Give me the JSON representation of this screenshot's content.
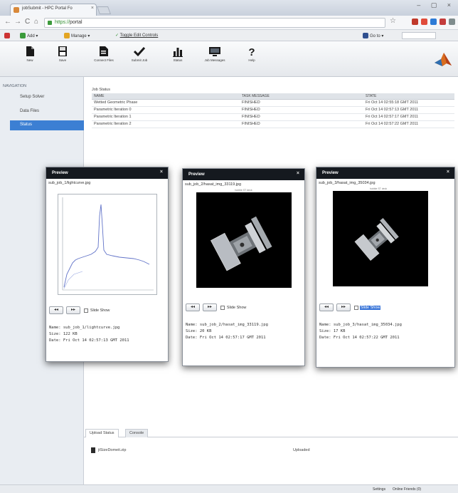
{
  "browser": {
    "tab_title": "jobSubmit - HPC Portal Fo",
    "tab_close": "×",
    "window_buttons": "– ▢ ×",
    "url_scheme": "https://",
    "url_rest": "portal",
    "bookmarks": {
      "add": "Add ▾",
      "manage": "Manage ▾",
      "toggle_edit": "Toggle Edit Controls",
      "go_to": "Go to ▾"
    },
    "ext_colors": [
      "#c0392b",
      "#e04b3a",
      "#2d7bd6",
      "#c43c3c",
      "#7f8c8d"
    ]
  },
  "toolbar": {
    "buttons": [
      {
        "label": "New",
        "icon": "file-icon"
      },
      {
        "label": "Save",
        "icon": "save-icon"
      },
      {
        "label": "Connect Files",
        "icon": "connect-files-icon"
      },
      {
        "label": "Submit Job",
        "icon": "checkmark-icon"
      },
      {
        "label": "Status",
        "icon": "bar-chart-icon"
      },
      {
        "label": "Job Messages",
        "icon": "monitor-icon"
      },
      {
        "label": "Help",
        "icon": "question-mark-icon"
      }
    ]
  },
  "sidebar": {
    "heading": "NAVIGATION",
    "items": [
      {
        "label": "Setup Solver",
        "active": false
      },
      {
        "label": "Data Files",
        "active": false
      },
      {
        "label": "Status",
        "active": true
      }
    ]
  },
  "job_status": {
    "title": "Job Status",
    "columns": [
      "NAME",
      "TASK MESSAGE",
      "STATE"
    ],
    "rows": [
      [
        "Wetted Geometric Phase",
        "FINISHED",
        "Fri Oct 14 02:55:18 GMT 2011"
      ],
      [
        "Parametric Iteration 0",
        "FINISHED",
        "Fri Oct 14 02:57:13 GMT 2011"
      ],
      [
        "Parametric Iteration 1",
        "FINISHED",
        "Fri Oct 14 02:57:17 GMT 2011"
      ],
      [
        "Parametric Iteration 2",
        "FINISHED",
        "Fri Oct 14 02:57:22 GMT 2011"
      ]
    ]
  },
  "previews": [
    {
      "title": "Preview",
      "close": "×",
      "filename": "sub_job_1/lightcurve.jpg",
      "kind": "plot",
      "controls": {
        "prev": "◂◂",
        "next": "▸▸",
        "slideshow": "Slide Show",
        "slideshow_selected": false
      },
      "meta": [
        "Name: sub_job_1/lightcurve.jpg",
        "Size: 122 KB",
        "Date: Fri Oct 14 02:57:13 GMT 2011"
      ]
    },
    {
      "title": "Preview",
      "close": "×",
      "filename": "sub_job_2/hasat_img_33119.jpg",
      "kind": "telescope",
      "caption": "hubble ST deck",
      "controls": {
        "prev": "◂◂",
        "next": "▸▸",
        "slideshow": "Slide Show",
        "slideshow_selected": false
      },
      "meta": [
        "Name: sub_job_2/hasat_img_33119.jpg",
        "Size: 20 KB",
        "Date: Fri Oct 14 02:57:17 GMT 2011"
      ]
    },
    {
      "title": "Preview",
      "close": "×",
      "filename": "sub_job_3/hasat_img_35034.jpg",
      "kind": "telescope",
      "caption": "hubble ST deck",
      "controls": {
        "prev": "◂◂",
        "next": "▸▸",
        "slideshow": "Slide Show",
        "slideshow_selected": true
      },
      "meta": [
        "Name: sub_job_3/hasat_img_35034.jpg",
        "Size: 17 KB",
        "Date: Fri Oct 14 02:57:22 GMT 2011"
      ]
    }
  ],
  "bottom": {
    "tabs": [
      {
        "label": "Upload Status",
        "active": true
      },
      {
        "label": "Console",
        "active": false
      }
    ],
    "upload_file": "jtSizeDomeit.zip",
    "upload_state": "Uploaded"
  },
  "status_bar": {
    "settings": "Settings",
    "online": "Online Friends (0)"
  }
}
